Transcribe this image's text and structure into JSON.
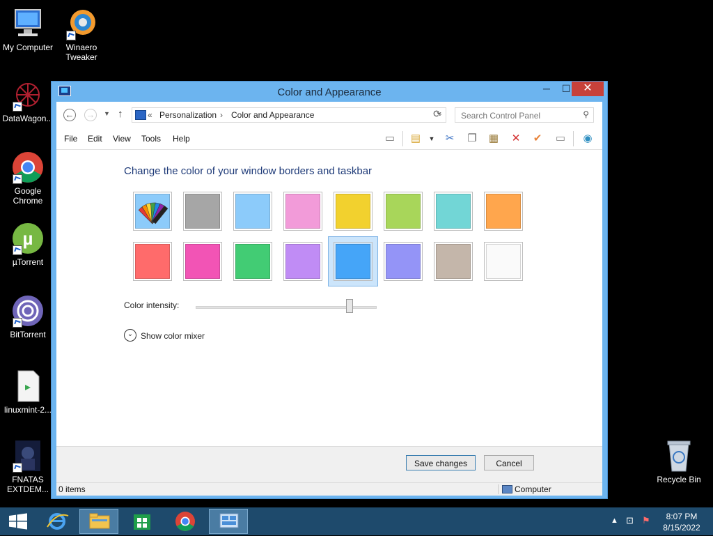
{
  "desktop": {
    "icons": [
      {
        "label": "My Computer"
      },
      {
        "label": "Winaero\nTweaker"
      },
      {
        "label": "DataWagon..."
      },
      {
        "label": "Google\nChrome"
      },
      {
        "label": "µTorrent"
      },
      {
        "label": "BitTorrent"
      },
      {
        "label": "linuxmint-2..."
      },
      {
        "label": "FNATAS\nEXTDEM..."
      },
      {
        "label": "Recycle Bin"
      }
    ]
  },
  "window": {
    "title": "Color and Appearance",
    "controls": {
      "minimize": "─",
      "maximize": "☐",
      "close": "✕"
    }
  },
  "address": {
    "back": "←",
    "forward": "→",
    "recent": "▼",
    "up": "↑",
    "chevron": "«",
    "crumbs": [
      "Personalization",
      "Color and Appearance"
    ],
    "separator": "›",
    "dropdown": "⌄",
    "refresh": "⟳",
    "search_placeholder": "Search Control Panel",
    "search_icon": "⚲"
  },
  "menu": [
    "File",
    "Edit",
    "View",
    "Tools",
    "Help"
  ],
  "toolbar": [
    {
      "icon": "layout-icon",
      "glyph": "▭",
      "color": "#777777"
    },
    {
      "icon": "folder-icon",
      "glyph": "▤",
      "color": "#d9a93a"
    },
    {
      "icon": "cut-icon",
      "glyph": "✂",
      "color": "#3a72c4"
    },
    {
      "icon": "copy-icon",
      "glyph": "❐",
      "color": "#666666"
    },
    {
      "icon": "paste-icon",
      "glyph": "▦",
      "color": "#9a7b3a"
    },
    {
      "icon": "delete-icon",
      "glyph": "✕",
      "color": "#d22a2a"
    },
    {
      "icon": "check-icon",
      "glyph": "✔",
      "color": "#e8833a"
    },
    {
      "icon": "properties-icon",
      "glyph": "▭",
      "color": "#888888"
    },
    {
      "icon": "shell-icon",
      "glyph": "◉",
      "color": "#2f8fc1"
    }
  ],
  "content": {
    "heading": "Change the color of your window borders and taskbar",
    "swatches_row1": [
      "auto",
      "#a6a6a6",
      "#8ccbfa",
      "#f29bd9",
      "#f2d12e",
      "#a8d65a",
      "#72d6d6",
      "#ffa64d"
    ],
    "swatches_row2": [
      "#ff6b6b",
      "#f254b5",
      "#42cc74",
      "#c08cf5",
      "#45a5f8",
      "#9494f7",
      "#c4b6aa",
      "#fafafa"
    ],
    "selected_swatch": 12,
    "intensity_label": "Color intensity:",
    "intensity_value": 0.85,
    "mixer_icon": "⌄",
    "mixer_label": "Show color mixer"
  },
  "footer": {
    "save": "Save changes",
    "cancel": "Cancel"
  },
  "status": {
    "items": "0 items",
    "location": "Computer"
  },
  "taskbar": {
    "time": "8:07 PM",
    "date": "8/15/2022"
  }
}
